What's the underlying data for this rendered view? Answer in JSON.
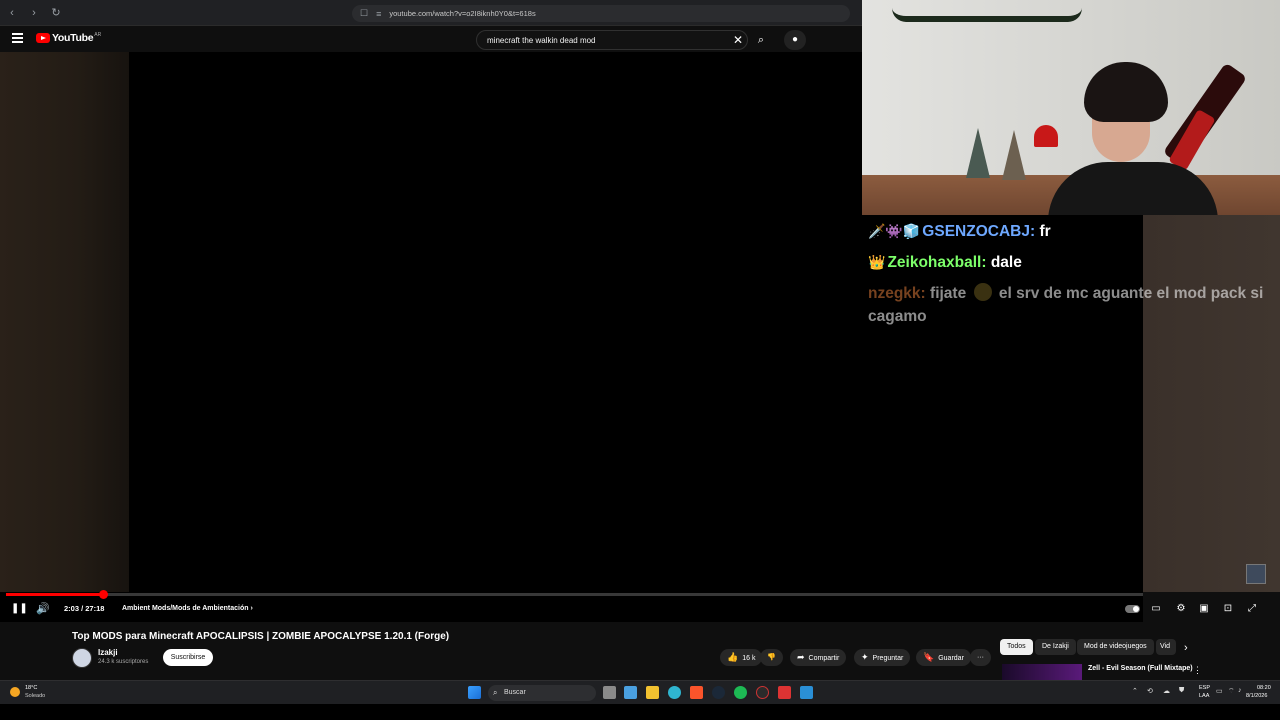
{
  "browser": {
    "url": "youtube.com/watch?v=o2I8iknh0Y0&t=618s",
    "nav_back": "‹",
    "nav_forward": "›",
    "nav_reload": "↻"
  },
  "youtube": {
    "logo_text": "YouTube",
    "region": "AR",
    "search_value": "minecraft the walkin dead mod"
  },
  "chat": {
    "messages": [
      {
        "user": "GSENZOCABJ:",
        "text": "fr",
        "user_color": "#6ea8ff",
        "badges": "🗡️👾🧊"
      },
      {
        "user": "Zeikohaxball:",
        "text": "dale",
        "user_color": "#7dff6a",
        "badges": "👑"
      },
      {
        "user": "nzegkk:",
        "text_before": "fijate",
        "text_after": "el srv de mc aguante el mod pack si cagamo",
        "user_color": "#d9783a"
      }
    ]
  },
  "player": {
    "time": "2:03 / 27:18",
    "chapter": "Ambient Mods/Mods de Ambientación",
    "chapter_arrow": "›",
    "progress": 0.085
  },
  "video": {
    "title": "Top MODS para Minecraft APOCALIPSIS | ZOMBIE APOCALYPSE 1.20.1 (Forge)",
    "channel": "Izakji",
    "subscribers": "24.3 k suscriptores",
    "subscribe_label": "Suscribirse",
    "likes": "16 k",
    "share_label": "Compartir",
    "ask_label": "Preguntar",
    "save_label": "Guardar",
    "more_label": "···"
  },
  "recommendations": {
    "chips": [
      "Todos",
      "De Izakji",
      "Mod de videojuegos",
      "Vid"
    ],
    "first_title": "Zell - Evil Season (Full Mixtape)"
  },
  "taskbar": {
    "temp": "18°C",
    "condition": "Soleado",
    "search_label": "Buscar",
    "lang_top": "ESP",
    "lang_bottom": "LAA",
    "time": "08:20",
    "date": "8/1/2026"
  },
  "colors": {
    "accent": "#ff0000",
    "background": "#0f0f0f"
  }
}
